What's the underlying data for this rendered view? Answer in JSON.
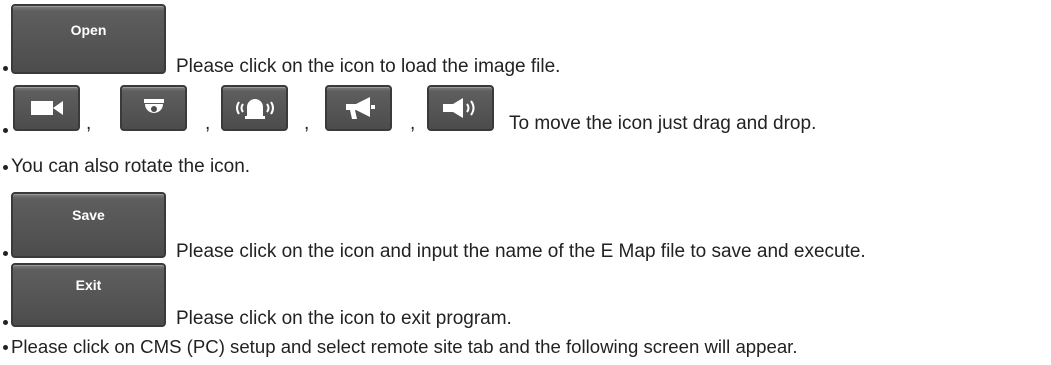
{
  "open": {
    "button_label": "Open",
    "text": "Please click on the icon to load the image file."
  },
  "icons": {
    "items": [
      {
        "name": "camera-icon"
      },
      {
        "name": "dome-camera-icon"
      },
      {
        "name": "alarm-light-icon"
      },
      {
        "name": "megaphone-icon"
      },
      {
        "name": "speaker-icon"
      }
    ],
    "separator": ",",
    "text": "To move the icon just drag and drop."
  },
  "rotate": {
    "text": "You can also rotate the icon."
  },
  "save": {
    "button_label": "Save",
    "text": "Please click on the icon and input the name of the E Map file to save and execute."
  },
  "exit": {
    "button_label": "Exit",
    "text": "Please click on the icon to exit program."
  },
  "cms": {
    "text": "Please click on CMS (PC) setup and select remote site tab and the following screen will appear."
  }
}
